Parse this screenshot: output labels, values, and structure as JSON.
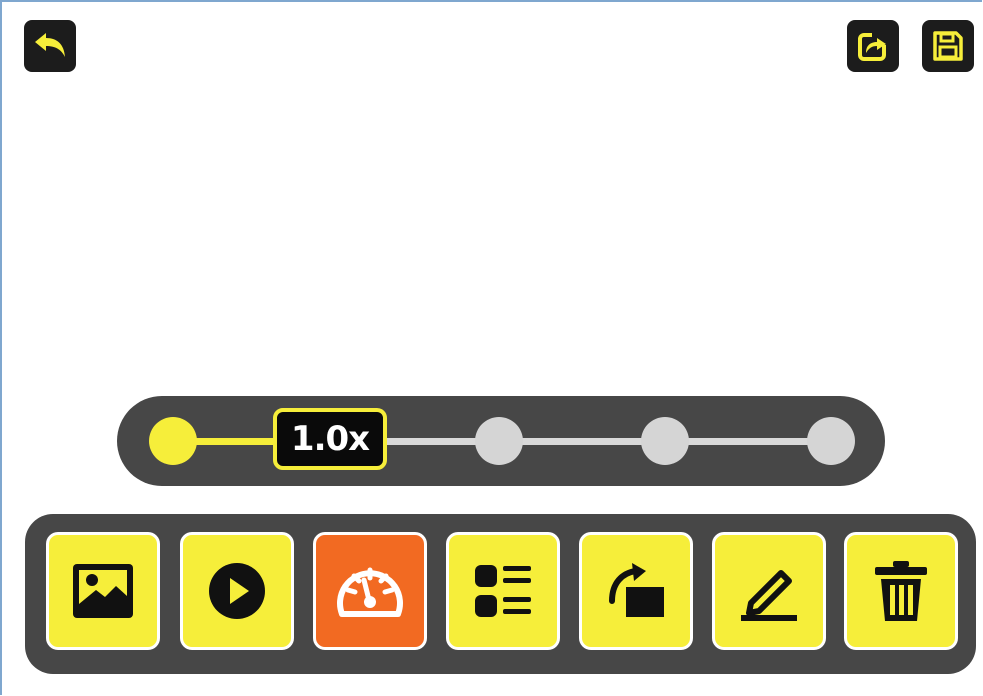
{
  "header": {
    "back_icon": "back-arrow-icon",
    "share_icon": "share-export-icon",
    "save_icon": "floppy-save-icon"
  },
  "speed_control": {
    "label": "1.0x",
    "positions": 5,
    "selected_index": 0
  },
  "toolbar": {
    "tools": [
      {
        "id": "image",
        "icon": "image-icon",
        "selected": false
      },
      {
        "id": "play",
        "icon": "play-icon",
        "selected": false
      },
      {
        "id": "speed",
        "icon": "speedometer-icon",
        "selected": true
      },
      {
        "id": "list",
        "icon": "list-icon",
        "selected": false
      },
      {
        "id": "rotate",
        "icon": "rotate-icon",
        "selected": false
      },
      {
        "id": "edit",
        "icon": "pencil-icon",
        "selected": false
      },
      {
        "id": "delete",
        "icon": "trash-icon",
        "selected": false
      }
    ]
  },
  "colors": {
    "accent_yellow": "#f6ee3a",
    "selected_orange": "#f26a22",
    "panel_gray": "#474747",
    "button_dark": "#1c1c1c",
    "inactive_dot": "#d5d5d5"
  }
}
